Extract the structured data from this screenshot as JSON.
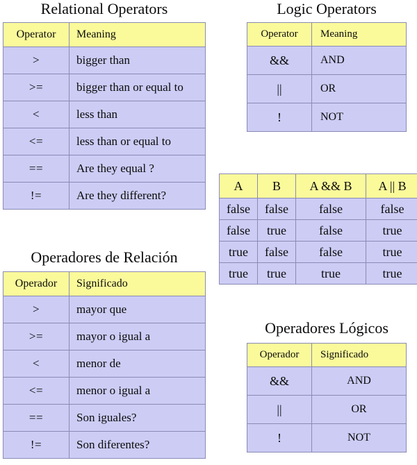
{
  "page": {
    "background_color": "#ffffff",
    "header_cell_color": "#fafa9b",
    "body_cell_color": "#ccccf5",
    "outer_border_color": "#2a2a2a",
    "inner_border_color": "#8a8ab4",
    "text_color": "#0b0b0b"
  },
  "relational_en": {
    "title": "Relational Operators",
    "headers": {
      "operator": "Operator",
      "meaning": "Meaning"
    },
    "rows": [
      {
        "operator": ">",
        "meaning": "bigger than"
      },
      {
        "operator": ">=",
        "meaning": "bigger than or equal to"
      },
      {
        "operator": "<",
        "meaning": "less than"
      },
      {
        "operator": "<=",
        "meaning": "less than or equal to"
      },
      {
        "operator": "==",
        "meaning": "Are they equal ?"
      },
      {
        "operator": "!=",
        "meaning": "Are they different?"
      }
    ]
  },
  "logic_en": {
    "title": "Logic Operators",
    "headers": {
      "operator": "Operator",
      "meaning": "Meaning"
    },
    "rows": [
      {
        "operator": "&&",
        "meaning": "AND"
      },
      {
        "operator": "||",
        "meaning": "OR"
      },
      {
        "operator": "!",
        "meaning": "NOT"
      }
    ]
  },
  "truth_table": {
    "headers": {
      "a": "A",
      "b": "B",
      "and": "A && B",
      "or": "A || B"
    },
    "rows": [
      {
        "a": "false",
        "b": "false",
        "and": "false",
        "or": "false"
      },
      {
        "a": "false",
        "b": "true",
        "and": "false",
        "or": "true"
      },
      {
        "a": "true",
        "b": "false",
        "and": "false",
        "or": "true"
      },
      {
        "a": "true",
        "b": "true",
        "and": "true",
        "or": "true"
      }
    ]
  },
  "relational_es": {
    "title": "Operadores de Relación",
    "headers": {
      "operator": "Operador",
      "meaning": "Significado"
    },
    "rows": [
      {
        "operator": ">",
        "meaning": "mayor que"
      },
      {
        "operator": ">=",
        "meaning": "mayor o igual a"
      },
      {
        "operator": "<",
        "meaning": "menor de"
      },
      {
        "operator": "<=",
        "meaning": "menor o igual a"
      },
      {
        "operator": "==",
        "meaning": "Son iguales?"
      },
      {
        "operator": "!=",
        "meaning": "Son diferentes?"
      }
    ]
  },
  "logic_es": {
    "title": "Operadores Lógicos",
    "headers": {
      "operator": "Operador",
      "meaning": "Significado"
    },
    "rows": [
      {
        "operator": "&&",
        "meaning": "AND"
      },
      {
        "operator": "||",
        "meaning": "OR"
      },
      {
        "operator": "!",
        "meaning": "NOT"
      }
    ]
  }
}
